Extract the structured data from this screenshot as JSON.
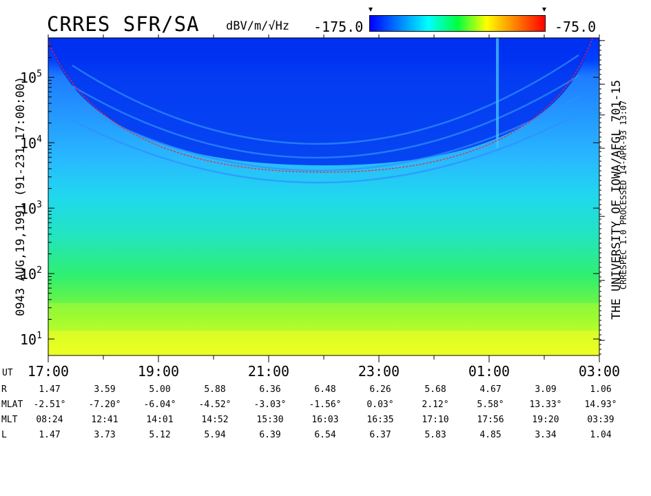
{
  "header": {
    "title": "CRRES SFR/SA",
    "units": "dBV/m/√Hz",
    "cb_min": "-175.0",
    "cb_max": "-75.0"
  },
  "left_label": "0943  AUG,19,1991  (91-231 17:00:00)",
  "right_label": "THE UNIVERSITY OF IOWA/AFGL  701-15",
  "right_sub": "CRRESPEC 1.0   PROCESSED 14-APR-93  13:07",
  "chart_data": {
    "type": "heatmap",
    "title": "CRRES SFR/SA",
    "colorbar": {
      "label": "dBV/m/√Hz",
      "min": -175.0,
      "max": -75.0,
      "colors": [
        "#0000ff",
        "#0080ff",
        "#00ffff",
        "#00ff40",
        "#ffff00",
        "#ff8000",
        "#ff0000"
      ]
    },
    "x_tick_labels": [
      "17:00",
      "19:00",
      "21:00",
      "23:00",
      "01:00",
      "03:00"
    ],
    "x_range_hours": [
      17,
      27
    ],
    "y_scale": "log",
    "y_ticks": [
      {
        "base": "10",
        "exp": "1",
        "value": 10
      },
      {
        "base": "10",
        "exp": "2",
        "value": 100
      },
      {
        "base": "10",
        "exp": "3",
        "value": 1000
      },
      {
        "base": "10",
        "exp": "4",
        "value": 10000
      },
      {
        "base": "10",
        "exp": "5",
        "value": 100000
      }
    ],
    "y_range": [
      5.6,
      400000
    ],
    "upper_hybrid_trace_L": [
      1.47,
      3.73,
      5.12,
      5.94,
      6.39,
      6.54,
      6.37,
      5.83,
      4.85,
      3.34,
      1.04
    ]
  },
  "ephemeris": {
    "ut_label": "UT",
    "rows": [
      {
        "label": "R",
        "values": [
          "1.47",
          "3.59",
          "5.00",
          "5.88",
          "6.36",
          "6.48",
          "6.26",
          "5.68",
          "4.67",
          "3.09",
          "1.06"
        ]
      },
      {
        "label": "MLAT",
        "values": [
          "-2.51°",
          "-7.20°",
          "-6.04°",
          "-4.52°",
          "-3.03°",
          "-1.56°",
          "0.03°",
          "2.12°",
          "5.58°",
          "13.33°",
          "14.93°"
        ]
      },
      {
        "label": "MLT",
        "values": [
          "08:24",
          "12:41",
          "14:01",
          "14:52",
          "15:30",
          "16:03",
          "16:35",
          "17:10",
          "17:56",
          "19:20",
          "03:39"
        ]
      },
      {
        "label": "L",
        "values": [
          "1.47",
          "3.73",
          "5.12",
          "5.94",
          "6.39",
          "6.54",
          "6.37",
          "5.83",
          "4.85",
          "3.34",
          "1.04"
        ]
      }
    ]
  }
}
